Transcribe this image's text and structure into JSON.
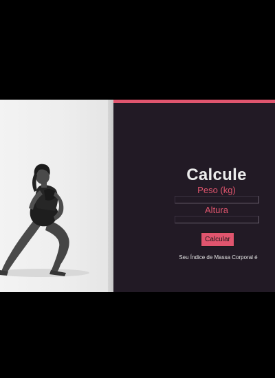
{
  "theme": {
    "accent": "#e0556e",
    "panel_bg": "#221a25",
    "page_bg": "#000000"
  },
  "photo": {
    "icon": "person-photo"
  },
  "calculator": {
    "title": "Calcule",
    "weight_label": "Peso (kg)",
    "weight_value": "",
    "height_label": "Altura",
    "height_value": "",
    "button_label": "Calcular",
    "result_text": "Seu Índice de Massa Corporal é"
  }
}
